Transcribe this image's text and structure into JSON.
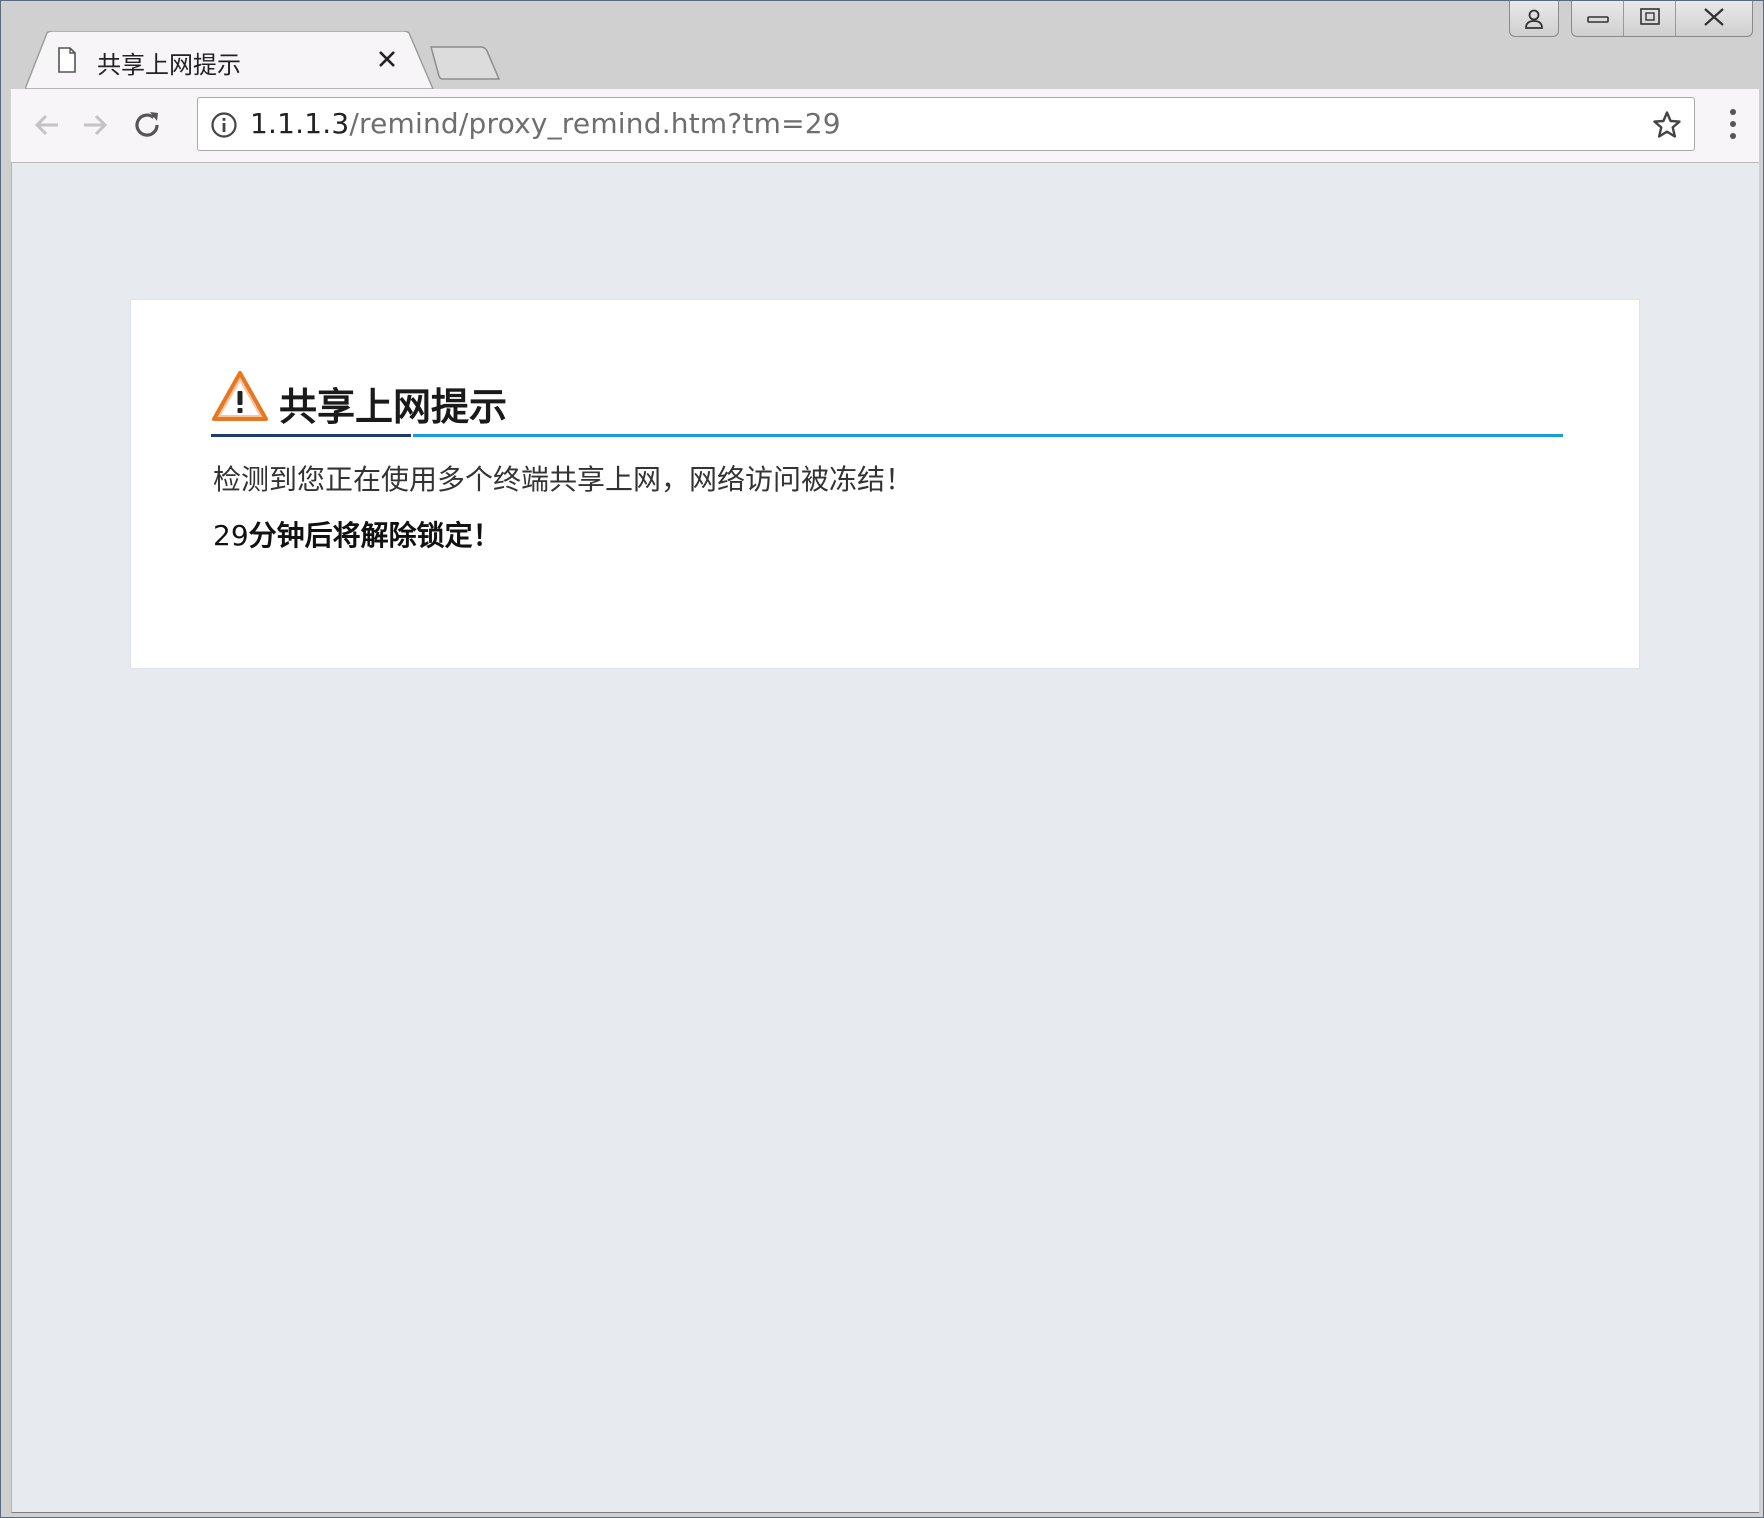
{
  "tab": {
    "title": "共享上网提示",
    "favicon_icon": "page-icon",
    "close_icon": "close-icon"
  },
  "window_controls": {
    "profile_icon": "person-icon",
    "minimize_icon": "minimize-icon",
    "restore_icon": "restore-icon",
    "close_icon": "close-icon"
  },
  "toolbar": {
    "back_icon": "arrow-left-icon",
    "forward_icon": "arrow-right-icon",
    "reload_icon": "reload-icon",
    "url_host": "1.1.1.3",
    "url_path": "/remind/proxy_remind.htm?tm=29",
    "info_icon": "info-icon",
    "bookmark_icon": "star-icon",
    "menu_icon": "kebab-menu-icon"
  },
  "notice": {
    "icon": "warning-icon",
    "heading": "共享上网提示",
    "message": "检测到您正在使用多个终端共享上网，网络访问被冻结！",
    "minutes": "29",
    "unlock_text": "分钟后将解除锁定！"
  },
  "colors": {
    "page_background": "#e7eaef",
    "accent_blue": "#1a9ddb",
    "accent_dark": "#1e3c70",
    "warning_orange": "#e87722"
  }
}
